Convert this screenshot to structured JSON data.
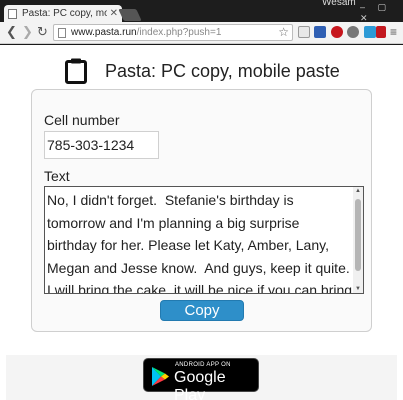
{
  "browser": {
    "tab_title": "Pasta: PC copy, mobi",
    "tab_close": "✕",
    "profile_name": "Wesam",
    "window_buttons": "– ▢ ✕",
    "back": "❮",
    "forward": "❯",
    "reload": "↻",
    "url_host": "www.pasta.run",
    "url_path": "/index.php?push=1",
    "star": "☆",
    "menu": "≡"
  },
  "header": {
    "title": "Pasta: PC copy, mobile paste"
  },
  "form": {
    "cell_label": "Cell number",
    "cell_value": "785-303-1234",
    "text_label": "Text",
    "text_value": "No, I didn't forget.  Stefanie's birthday is tomorrow and I'm planning a big surprise birthday for her. Please let Katy, Amber, Lany, Megan and Jesse know.  And guys, keep it quite.  I will bring the cake, it will be nice if you can bring snacks.",
    "copy_label": "Copy"
  },
  "footer": {
    "badge_small": "ANDROID APP ON",
    "badge_big": "Google Play"
  },
  "colors": {
    "accent": "#2e8fc9",
    "chrome_dark": "#1d1d1d"
  }
}
